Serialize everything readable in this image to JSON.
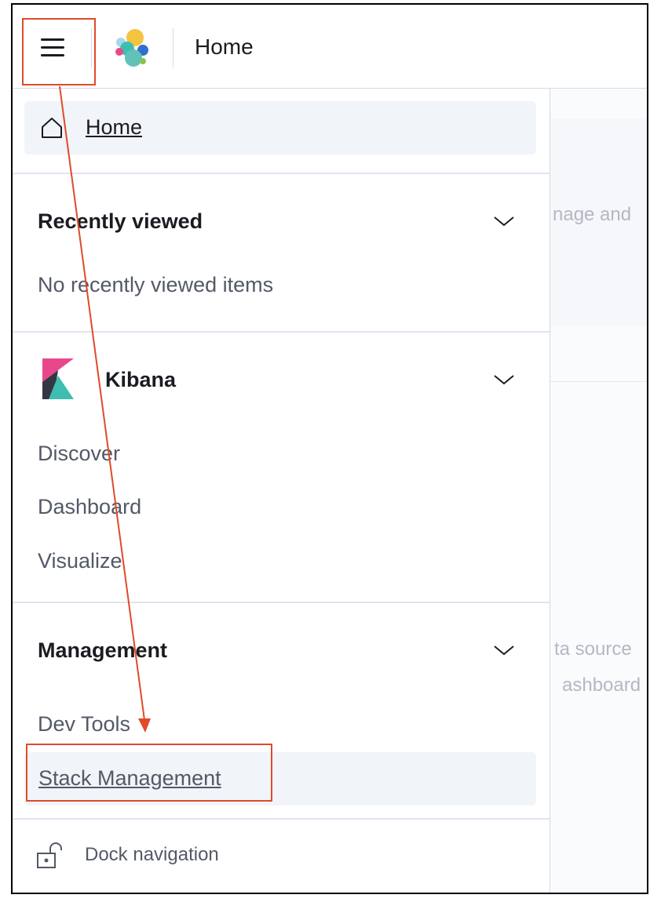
{
  "header": {
    "title": "Home",
    "menu_icon": "hamburger-menu-icon",
    "logo_icon": "elastic-logo-icon"
  },
  "background": {
    "snippet_1": "nage and",
    "snippet_2": "ta source",
    "snippet_3": "ashboard"
  },
  "nav": {
    "home": {
      "label": "Home",
      "icon": "home-icon"
    },
    "recently_viewed": {
      "title": "Recently viewed",
      "empty_text": "No recently viewed items"
    },
    "kibana": {
      "title": "Kibana",
      "items": [
        "Discover",
        "Dashboard",
        "Visualize"
      ]
    },
    "management": {
      "title": "Management",
      "items": [
        "Dev Tools",
        "Stack Management"
      ]
    },
    "dock": {
      "label": "Dock navigation",
      "icon": "lock-icon"
    }
  },
  "colors": {
    "annotation": "#e04a2a",
    "kibana_pink": "#e8488b",
    "kibana_teal": "#3ebeb0",
    "kibana_dark": "#343741"
  }
}
